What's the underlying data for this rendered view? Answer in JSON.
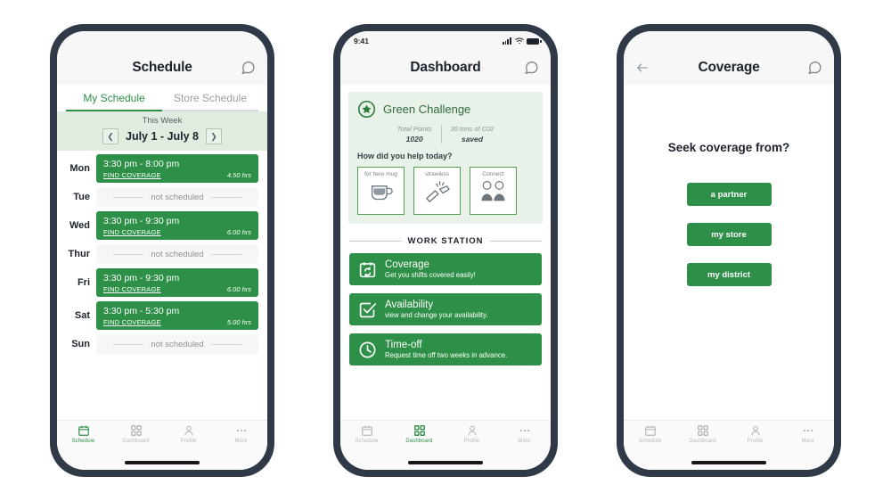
{
  "screens": [
    {
      "id": "schedule",
      "statusbar": {
        "time": "",
        "visible": false
      },
      "nav": {
        "title": "Schedule",
        "chat_icon": "chat-bubble-icon"
      },
      "tabs": [
        {
          "label": "My Schedule",
          "active": true
        },
        {
          "label": "Store Schedule",
          "active": false
        }
      ],
      "week": {
        "label": "This Week",
        "range": "July 1 - July 8",
        "prev_icon": "chevron-left-icon",
        "next_icon": "chevron-right-icon"
      },
      "schedule_rows": [
        {
          "day": "Mon",
          "scheduled": true,
          "time": "3:30 pm - 8:00 pm",
          "action": "FIND COVERAGE",
          "hours": "4.50 hrs",
          "empty_text": ""
        },
        {
          "day": "Tue",
          "scheduled": false,
          "time": "",
          "action": "",
          "hours": "",
          "empty_text": "not scheduled"
        },
        {
          "day": "Wed",
          "scheduled": true,
          "time": "3:30 pm - 9:30 pm",
          "action": "FIND COVERAGE",
          "hours": "6.00 hrs",
          "empty_text": ""
        },
        {
          "day": "Thur",
          "scheduled": false,
          "time": "",
          "action": "",
          "hours": "",
          "empty_text": "not scheduled"
        },
        {
          "day": "Fri",
          "scheduled": true,
          "time": "3:30 pm - 9:30 pm",
          "action": "FIND COVERAGE",
          "hours": "6.00 hrs",
          "empty_text": ""
        },
        {
          "day": "Sat",
          "scheduled": true,
          "time": "3:30 pm - 5:30 pm",
          "action": "FIND COVERAGE",
          "hours": "5.00 hrs",
          "empty_text": ""
        },
        {
          "day": "Sun",
          "scheduled": false,
          "time": "",
          "action": "",
          "hours": "",
          "empty_text": "not scheduled"
        }
      ],
      "tabbar": [
        {
          "label": "Schedule",
          "icon": "calendar-icon",
          "active": true
        },
        {
          "label": "Dashboard",
          "icon": "grid-icon",
          "active": false
        },
        {
          "label": "Profile",
          "icon": "person-icon",
          "active": false
        },
        {
          "label": "More",
          "icon": "ellipsis-icon",
          "active": false
        }
      ]
    },
    {
      "id": "dashboard",
      "statusbar": {
        "time": "9:41",
        "visible": true
      },
      "nav": {
        "title": "Dashboard",
        "chat_icon": "chat-bubble-icon"
      },
      "green_challenge": {
        "title": "Green Challenge",
        "badge_icon": "star-badge-icon",
        "stats": [
          {
            "label": "Total Points",
            "value": "1020"
          },
          {
            "label": "30 tons of C02",
            "value": "saved"
          }
        ],
        "question": "How did you help today?",
        "options": [
          {
            "label": "for here mug",
            "icon": "mug-icon"
          },
          {
            "label": "strawless",
            "icon": "broken-straw-icon"
          },
          {
            "label": "Connect",
            "icon": "two-people-icon"
          }
        ]
      },
      "section_title": "WORK STATION",
      "work_cards": [
        {
          "title": "Coverage",
          "subtitle": "Get you shifts covered easily!",
          "icon": "calendar-refresh-icon"
        },
        {
          "title": "Availability",
          "subtitle": "view and change your availability.",
          "icon": "checkbox-icon"
        },
        {
          "title": "Time-off",
          "subtitle": "Request time off two weeks in advance.",
          "icon": "clock-icon"
        }
      ],
      "tabbar": [
        {
          "label": "Schedule",
          "icon": "calendar-icon",
          "active": false
        },
        {
          "label": "Dashboard",
          "icon": "grid-icon",
          "active": true
        },
        {
          "label": "Profile",
          "icon": "person-icon",
          "active": false
        },
        {
          "label": "More",
          "icon": "ellipsis-icon",
          "active": false
        }
      ]
    },
    {
      "id": "coverage",
      "statusbar": {
        "time": "",
        "visible": false
      },
      "nav": {
        "title": "Coverage",
        "back_icon": "arrow-left-icon",
        "chat_icon": "chat-bubble-icon"
      },
      "question": "Seek coverage from?",
      "buttons": [
        {
          "label": "a partner"
        },
        {
          "label": "my store"
        },
        {
          "label": "my district"
        }
      ],
      "tabbar": [
        {
          "label": "Schedule",
          "icon": "calendar-icon",
          "active": false
        },
        {
          "label": "Dashboard",
          "icon": "grid-icon",
          "active": false
        },
        {
          "label": "Profile",
          "icon": "person-icon",
          "active": false
        },
        {
          "label": "More",
          "icon": "ellipsis-icon",
          "active": false
        }
      ]
    }
  ],
  "colors": {
    "brand_green": "#2e9048",
    "light_green_band": "#dfecdf",
    "card_mint": "#e8f2e8",
    "frame_dark": "#2f3947",
    "muted_gray": "#8d9398"
  }
}
